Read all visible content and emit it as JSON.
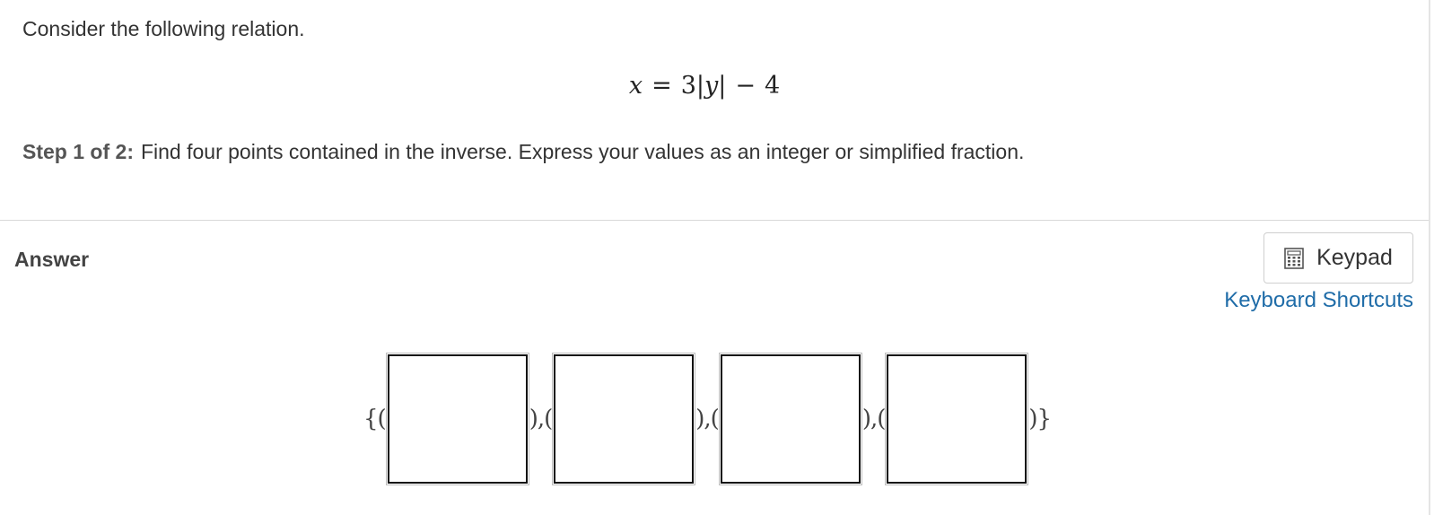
{
  "question": {
    "intro": "Consider the following relation.",
    "equation": {
      "lhs": "x",
      "equals": "=",
      "coefficient": "3",
      "abs_open": "|",
      "variable": "y",
      "abs_close": "|",
      "minus": "−",
      "constant": "4"
    },
    "step_label": "Step 1 of 2",
    "step_colon": ":",
    "step_text": "Find four points contained in the inverse. Express your values as an integer or simplified fraction."
  },
  "answer": {
    "title": "Answer",
    "keypad_label": "Keypad",
    "keypad_icon": "calculator-icon",
    "keyboard_shortcuts_label": "Keyboard Shortcuts",
    "open": "{(",
    "separator_1": "),(",
    "separator_2": "),(",
    "separator_3": "),(",
    "close": ")}",
    "boxes": [
      {
        "value": ""
      },
      {
        "value": ""
      },
      {
        "value": ""
      },
      {
        "value": ""
      }
    ]
  },
  "colors": {
    "link": "#1f6ca8",
    "text": "#333333",
    "divider": "#d8d8d8"
  }
}
